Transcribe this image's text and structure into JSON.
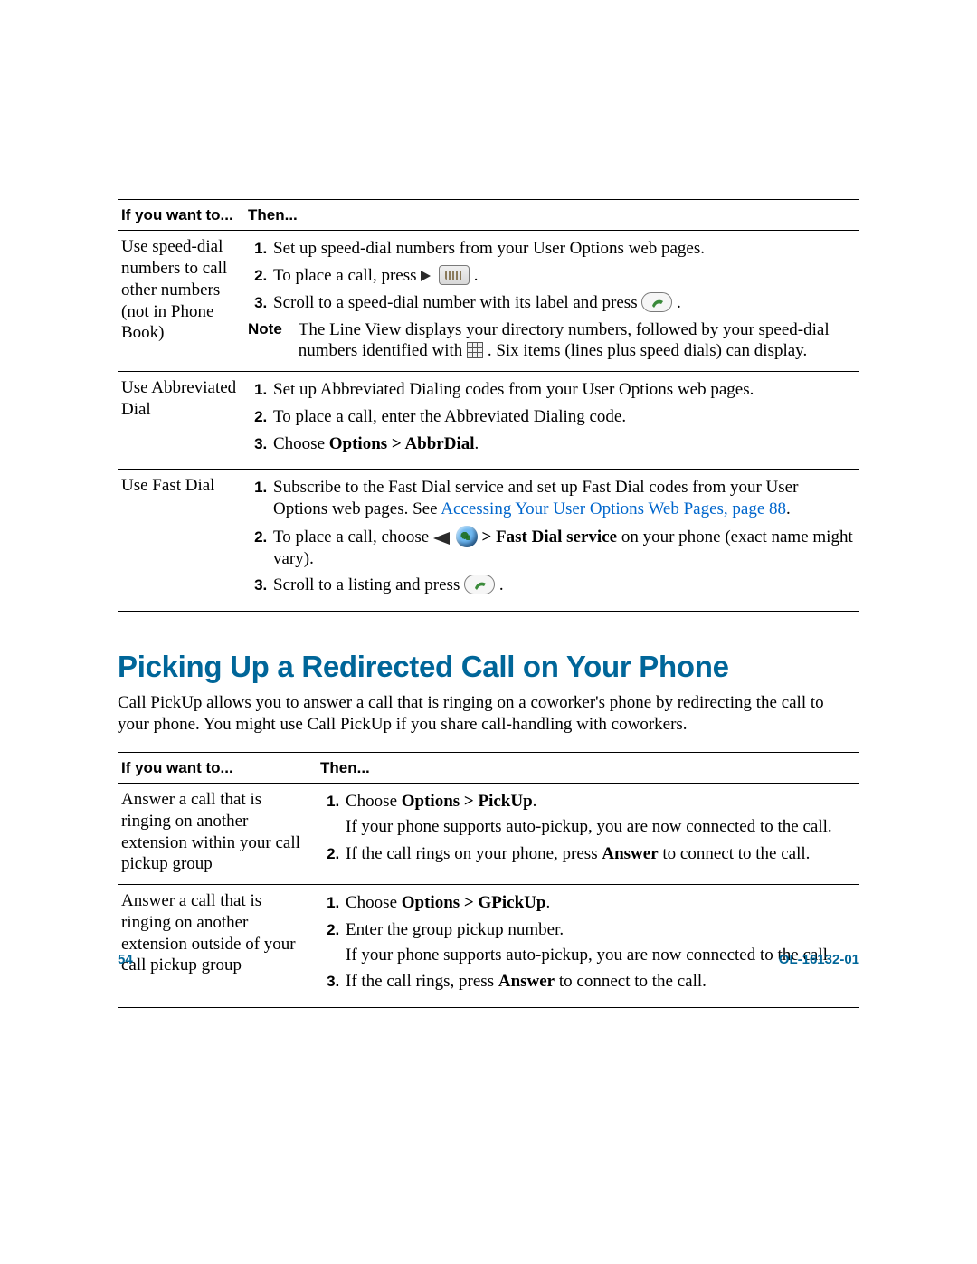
{
  "table1": {
    "headers": {
      "if": "If you want to...",
      "then": "Then..."
    },
    "rows": [
      {
        "if": "Use speed-dial numbers to call other numbers (not in Phone Book)",
        "steps": {
          "s1": "Set up speed-dial numbers from your User Options web pages.",
          "s2a": "To place a call, press ",
          "s2b": " .",
          "s3a": "Scroll to a speed-dial number with its label and press ",
          "s3b": " ."
        },
        "note": {
          "label": "Note",
          "text_a": "The Line View displays your directory numbers, followed by your speed-dial numbers identified with ",
          "text_b": " . Six items (lines plus speed dials) can display."
        }
      },
      {
        "if": "Use Abbreviated Dial",
        "steps": {
          "s1": "Set up Abbreviated Dialing codes from your User Options web pages.",
          "s2": "To place a call, enter the Abbreviated Dialing code.",
          "s3a": "Choose ",
          "s3b": "Options > AbbrDial",
          "s3c": "."
        }
      },
      {
        "if": "Use Fast Dial",
        "steps": {
          "s1a": "Subscribe to the Fast Dial service and set up Fast Dial codes from your User Options web pages. See ",
          "s1b": "Accessing Your User Options Web Pages, page 88",
          "s1c": ".",
          "s2a": "To place a call, choose ",
          "s2b": " > Fast Dial service",
          "s2c": " on your phone (exact name might vary).",
          "s3a": "Scroll to a listing and press ",
          "s3b": " ."
        }
      }
    ]
  },
  "section": {
    "heading": "Picking Up a Redirected Call on Your Phone",
    "body": "Call PickUp allows you to answer a call that is ringing on a coworker's phone by redirecting the call to your phone. You might use Call PickUp if you share call-handling with coworkers."
  },
  "table2": {
    "headers": {
      "if": "If you want to...",
      "then": "Then..."
    },
    "rows": [
      {
        "if": "Answer a call that is ringing on another extension within your call pickup group",
        "steps": {
          "s1a": "Choose ",
          "s1b": "Options > PickUp",
          "s1c": ".",
          "s1d": "If your phone supports auto-pickup, you are now connected to the call.",
          "s2a": "If the call rings on your phone, press ",
          "s2b": "Answer",
          "s2c": " to connect to the call."
        }
      },
      {
        "if": "Answer a call that is ringing on another extension outside of your call pickup group",
        "steps": {
          "s1a": "Choose ",
          "s1b": "Options > GPickUp",
          "s1c": ".",
          "s2": "Enter the group pickup number.",
          "s2d": "If your phone supports auto-pickup, you are now connected to the call.",
          "s3a": "If the call rings, press ",
          "s3b": "Answer",
          "s3c": " to connect to the call."
        }
      }
    ]
  },
  "footer": {
    "page": "54",
    "docnum": "OL-16132-01"
  }
}
